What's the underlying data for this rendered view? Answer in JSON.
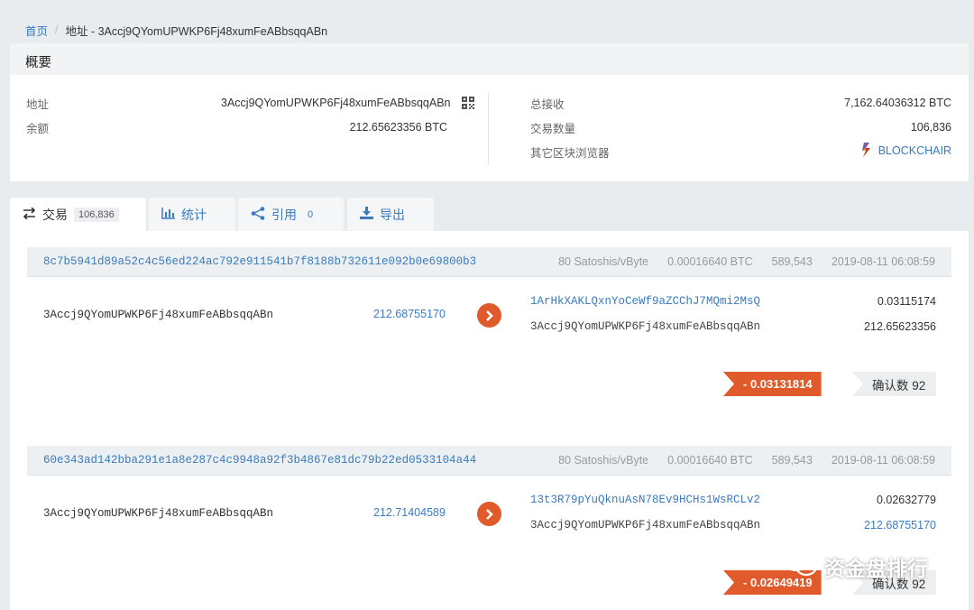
{
  "breadcrumb": {
    "home": "首页",
    "separator": "/",
    "current": "地址 - 3Accj9QYomUPWKP6Fj48xumFeABbsqqABn"
  },
  "overview": {
    "heading": "概要",
    "address_label": "地址",
    "address_value": "3Accj9QYomUPWKP6Fj48xumFeABbsqqABn",
    "balance_label": "余额",
    "balance_value": "212.65623356 BTC",
    "total_received_label": "总接收",
    "total_received_value": "7,162.64036312 BTC",
    "tx_count_label": "交易数量",
    "tx_count_value": "106,836",
    "other_explorers_label": "其它区块浏览器",
    "explorer_link": "BLOCKCHAIR"
  },
  "tabs": [
    {
      "icon": "swap-arrows-icon",
      "label": "交易",
      "count": "106,836"
    },
    {
      "icon": "bar-chart-icon",
      "label": "统计",
      "count": ""
    },
    {
      "icon": "share-icon",
      "label": "引用",
      "count": "0"
    },
    {
      "icon": "download-icon",
      "label": "导出",
      "count": ""
    }
  ],
  "transactions": [
    {
      "hash": "8c7b5941d89a52c4c56ed224ac792e911541b7f8188b732611e092b0e69800b3",
      "fee_rate": "80 Satoshis/vByte",
      "fee": "0.00016640 BTC",
      "block": "589,543",
      "time": "2019-08-11 06:08:59",
      "input_address": "3Accj9QYomUPWKP6Fj48xumFeABbsqqABn",
      "input_amount": "212.68755170",
      "outputs": [
        {
          "address": "1ArHkXAKLQxnYoCeWf9aZCChJ7MQmi2MsQ",
          "amount": "0.03115174"
        },
        {
          "address": "3Accj9QYomUPWKP6Fj48xumFeABbsqqABn",
          "amount": "212.65623356"
        }
      ],
      "delta": "- 0.03131814",
      "confirmations": "确认数 92"
    },
    {
      "hash": "60e343ad142bba291e1a8e287c4c9948a92f3b4867e81dc79b22ed0533104a44",
      "fee_rate": "80 Satoshis/vByte",
      "fee": "0.00016640 BTC",
      "block": "589,543",
      "time": "2019-08-11 06:08:59",
      "input_address": "3Accj9QYomUPWKP6Fj48xumFeABbsqqABn",
      "input_amount": "212.71404589",
      "outputs": [
        {
          "address": "13t3R79pYuQknuAsN78Ev9HCHs1WsRCLv2",
          "amount": "0.02632779"
        },
        {
          "address": "3Accj9QYomUPWKP6Fj48xumFeABbsqqABn",
          "amount": "212.68755170"
        }
      ],
      "delta": "- 0.02649419",
      "confirmations": "确认数 92"
    }
  ],
  "watermark": "资金盘排行",
  "colors": {
    "accent": "#3a7bbf",
    "negative": "#e05a2b",
    "background": "#e9ecef"
  }
}
